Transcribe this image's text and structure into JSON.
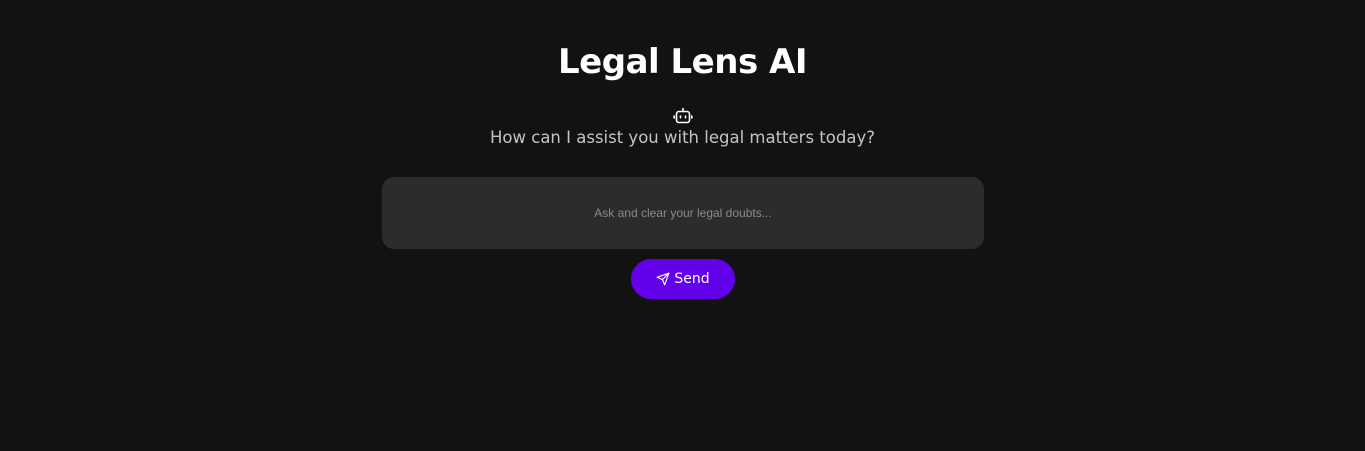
{
  "app": {
    "title": "Legal Lens AI",
    "subtitle": "How can I assist you with legal matters today?",
    "header_icon": "robot-icon"
  },
  "chat": {
    "input_value": "",
    "input_placeholder": "Ask and clear your legal doubts...",
    "send_label": "Send",
    "send_icon": "send-icon"
  },
  "colors": {
    "background": "#121212",
    "input_background": "#2c2c2c",
    "accent": "#6200ea",
    "subtitle_text": "#c4c4c4",
    "placeholder_text": "#8a8a8a"
  }
}
